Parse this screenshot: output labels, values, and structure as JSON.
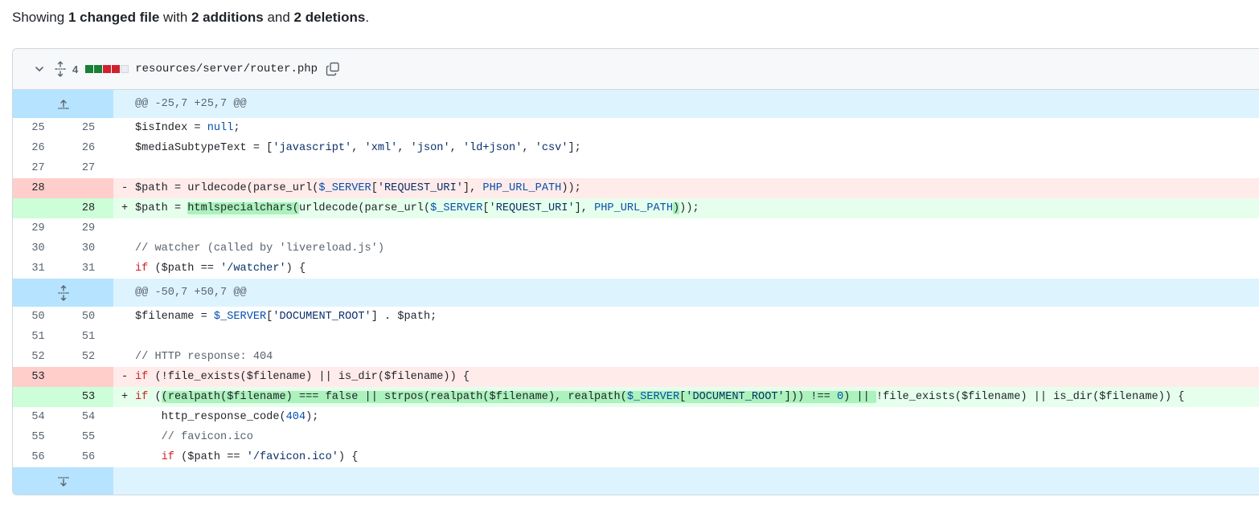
{
  "summary": {
    "prefix": "Showing ",
    "changed": "1 changed file",
    "mid1": " with ",
    "additions": "2 additions",
    "mid2": " and ",
    "deletions": "2 deletions",
    "suffix": "."
  },
  "file": {
    "change_count": "4",
    "name": "resources/server/router.php",
    "blocks": [
      "#1a7f37",
      "#1a7f37",
      "#cf222e",
      "#cf222e",
      "#eaeef2"
    ]
  },
  "hunks": [
    {
      "header": "@@ -25,7 +25,7 @@"
    },
    {
      "header": "@@ -50,7 +50,7 @@"
    }
  ],
  "lines": [
    {
      "l": "25",
      "r": "25"
    },
    {
      "l": "26",
      "r": "26"
    },
    {
      "l": "27",
      "r": "27"
    },
    {
      "l": "28",
      "r": "",
      "marker": "-"
    },
    {
      "l": "",
      "r": "28",
      "marker": "+"
    },
    {
      "l": "29",
      "r": "29"
    },
    {
      "l": "30",
      "r": "30"
    },
    {
      "l": "31",
      "r": "31"
    },
    {
      "l": "50",
      "r": "50"
    },
    {
      "l": "51",
      "r": "51"
    },
    {
      "l": "52",
      "r": "52"
    },
    {
      "l": "53",
      "r": "",
      "marker": "-"
    },
    {
      "l": "",
      "r": "53",
      "marker": "+"
    },
    {
      "l": "54",
      "r": "54"
    },
    {
      "l": "55",
      "r": "55"
    },
    {
      "l": "56",
      "r": "56"
    }
  ],
  "code": {
    "c25": [
      "$isIndex = ",
      "null",
      ";"
    ],
    "c26": [
      "$mediaSubtypeText = [",
      "'javascript'",
      ", ",
      "'xml'",
      ", ",
      "'json'",
      ", ",
      "'ld+json'",
      ", ",
      "'csv'",
      "];"
    ],
    "c28d": [
      "$path = urldecode(parse_url(",
      "$_SERVER",
      "[",
      "'REQUEST_URI'",
      "], ",
      "PHP_URL_PATH",
      "));"
    ],
    "c28a": [
      "$path = ",
      "htmlspecialchars(",
      "urldecode(parse_url(",
      "$_SERVER",
      "[",
      "'REQUEST_URI'",
      "], ",
      "PHP_URL_PATH",
      ")",
      "));"
    ],
    "c30": "// watcher (called by 'livereload.js')",
    "c31": [
      "if",
      " ($path == ",
      "'/watcher'",
      ") {"
    ],
    "c50": [
      "$filename = ",
      "$_SERVER",
      "[",
      "'DOCUMENT_ROOT'",
      "] . $path;"
    ],
    "c52": "// HTTP response: 404",
    "c53d": [
      "if",
      " (!file_exists($filename) || is_dir($filename)) {"
    ],
    "c53a": [
      "if",
      " (",
      "(realpath($filename) === false || strpos(realpath($filename), realpath(",
      "$_SERVER",
      "[",
      "'DOCUMENT_ROOT'",
      "])) !== ",
      "0",
      ") || ",
      "!file_exists($filename) || is_dir($filename)) {"
    ],
    "c54": [
      "http_response_code(",
      "404",
      ");"
    ],
    "c55": "// favicon.ico",
    "c56": [
      "if",
      " ($path == ",
      "'/favicon.ico'",
      ") {"
    ]
  }
}
